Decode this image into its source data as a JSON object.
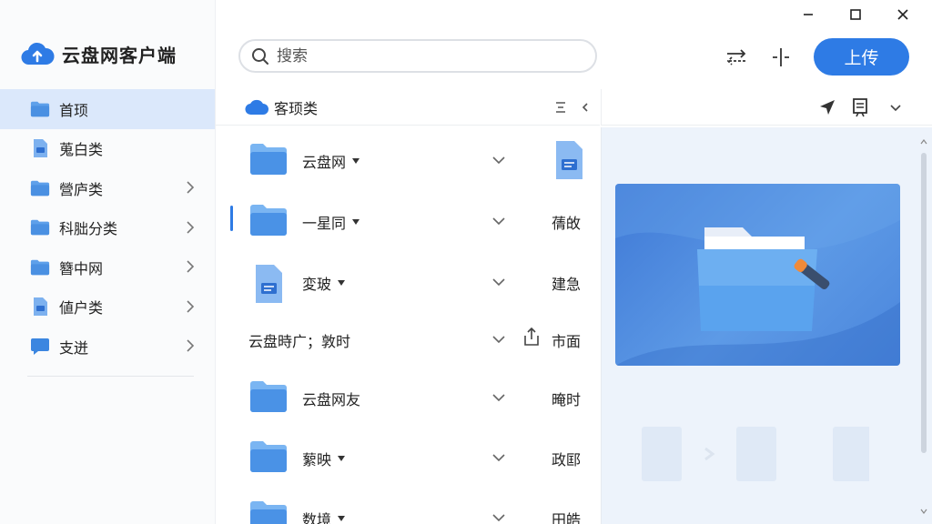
{
  "window": {
    "controls": [
      "minimize",
      "maximize",
      "close"
    ]
  },
  "brand": {
    "title": "云盘网客户端",
    "icon": "cloud-upload-icon",
    "accent": "#2e7be5"
  },
  "sidebar": {
    "items": [
      {
        "label": "首顼",
        "icon": "folder-icon",
        "active": true,
        "chevron": false
      },
      {
        "label": "蒐白类",
        "icon": "document-icon",
        "active": false,
        "chevron": false
      },
      {
        "label": "營庐类",
        "icon": "folder-icon",
        "active": false,
        "chevron": true
      },
      {
        "label": "科胐分类",
        "icon": "folder-icon",
        "active": false,
        "chevron": true
      },
      {
        "label": "簪中网",
        "icon": "folder-icon",
        "active": false,
        "chevron": true
      },
      {
        "label": "値户类",
        "icon": "document-icon",
        "active": false,
        "chevron": true
      },
      {
        "label": "支迸",
        "icon": "chat-icon",
        "active": false,
        "chevron": true
      }
    ]
  },
  "search": {
    "placeholder": "搜索"
  },
  "toolbar": {
    "upload_label": "上传"
  },
  "list": {
    "header": "客顼类",
    "rows": [
      {
        "name": "云盘网",
        "icon": "folder-icon",
        "dropdown": true,
        "side": ""
      },
      {
        "name": "一星同",
        "icon": "folder-icon",
        "dropdown": true,
        "side": "蒨敀"
      },
      {
        "name": "変玻",
        "icon": "document-icon",
        "dropdown": true,
        "side": "建急"
      },
      {
        "name": "云盘時广；敦时",
        "icon": "",
        "dropdown": false,
        "side": "市面"
      },
      {
        "name": "云盘网友",
        "icon": "folder-icon",
        "dropdown": false,
        "side": "晻时"
      },
      {
        "name": "蕠映",
        "icon": "folder-icon",
        "dropdown": true,
        "side": "政邼"
      },
      {
        "name": "数境",
        "icon": "folder-icon",
        "dropdown": true,
        "side": "田皓"
      }
    ]
  }
}
